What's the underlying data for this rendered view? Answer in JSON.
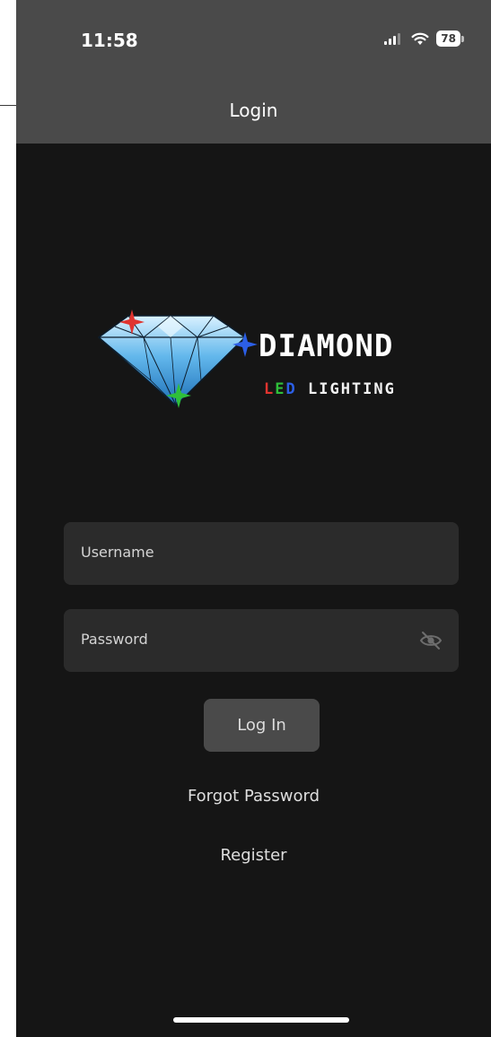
{
  "status_bar": {
    "time": "11:58",
    "battery": "78",
    "icons": [
      "signal-icon",
      "wifi-icon",
      "battery-icon"
    ]
  },
  "nav": {
    "title": "Login"
  },
  "logo": {
    "word": "DIAMOND",
    "sub_l": "L",
    "sub_e": "E",
    "sub_d": "D",
    "sub_rest": " LIGHTING",
    "colors": {
      "red": "#e0342f",
      "green": "#2fbf3a",
      "blue": "#2c5fe6",
      "white": "#ffffff"
    }
  },
  "form": {
    "username_placeholder": "Username",
    "password_placeholder": "Password",
    "toggle_icon": "eye-slash-icon",
    "login_label": "Log In"
  },
  "links": {
    "forgot_password": "Forgot Password",
    "register": "Register"
  },
  "colors": {
    "background": "#151515",
    "header": "#4a4a4a",
    "field": "#2b2b2b",
    "button": "#4a4a4a"
  }
}
